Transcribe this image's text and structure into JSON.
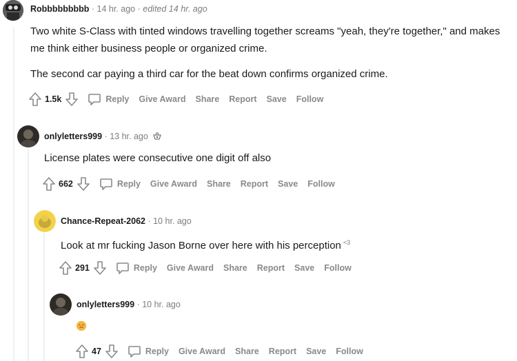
{
  "comments": [
    {
      "username": "Robbbbbbbbb",
      "time": "14 hr. ago",
      "edited": "edited 14 hr. ago",
      "body": [
        "Two white S-Class with tinted windows travelling together screams \"yeah, they're together,\" and makes me think either business people or organized crime.",
        "The second car paying a third car for the beat down confirms organized crime."
      ],
      "score": "1.5k"
    },
    {
      "username": "onlyletters999",
      "time": "13 hr. ago",
      "body": [
        "License plates were consecutive one digit off also"
      ],
      "score": "662"
    },
    {
      "username": "Chance-Repeat-2062",
      "time": "10 hr. ago",
      "body": [
        "Look at mr fucking Jason Borne over here with his perception"
      ],
      "heart": "<3",
      "score": "291"
    },
    {
      "username": "onlyletters999",
      "time": "10 hr. ago",
      "body": [],
      "score": "47"
    }
  ],
  "actions": {
    "reply": "Reply",
    "give_award": "Give Award",
    "share": "Share",
    "report": "Report",
    "save": "Save",
    "follow": "Follow"
  },
  "separator": "·"
}
